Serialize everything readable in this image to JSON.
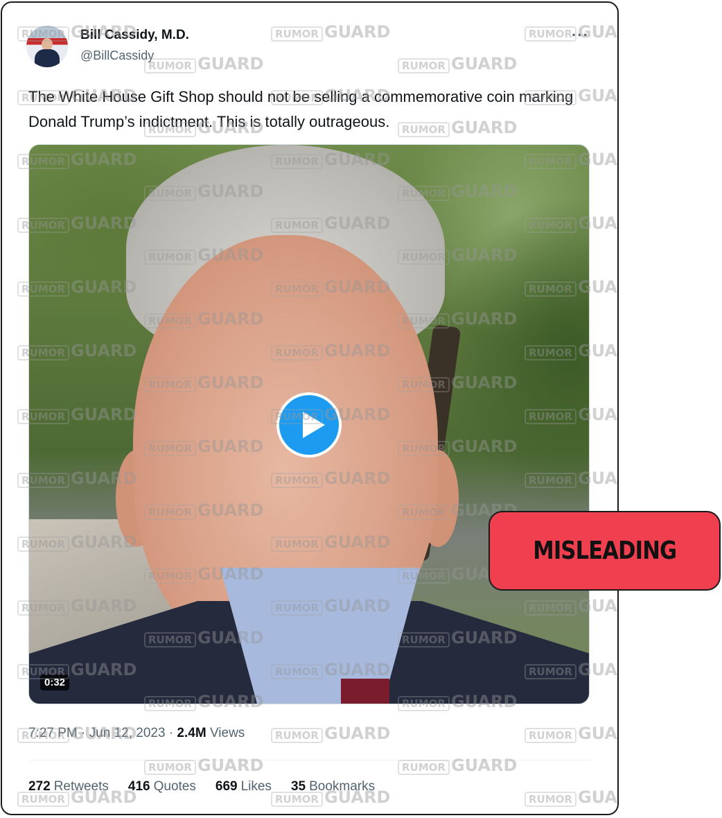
{
  "tweet": {
    "author_name": "Bill Cassidy, M.D.",
    "author_handle": "@BillCassidy",
    "more_label": "···",
    "text": "The White House Gift Shop should not be selling a commemorative coin marking Donald Trump’s indictment. This is totally outrageous.",
    "video_duration": "0:32",
    "time": "7:27 PM",
    "date": "Jun 12, 2023",
    "separator": "·",
    "views_count": "2.4M",
    "views_label": "Views"
  },
  "stats": [
    {
      "count": "272",
      "label": "Retweets"
    },
    {
      "count": "416",
      "label": "Quotes"
    },
    {
      "count": "669",
      "label": "Likes"
    },
    {
      "count": "35",
      "label": "Bookmarks"
    }
  ],
  "watermark": {
    "rumor": "RUMOR",
    "guard": "GUARD"
  },
  "badge": {
    "label": "MISLEADING",
    "color": "#f0404f"
  },
  "colors": {
    "play_button": "#1d9bf0",
    "secondary_text": "#536471"
  }
}
